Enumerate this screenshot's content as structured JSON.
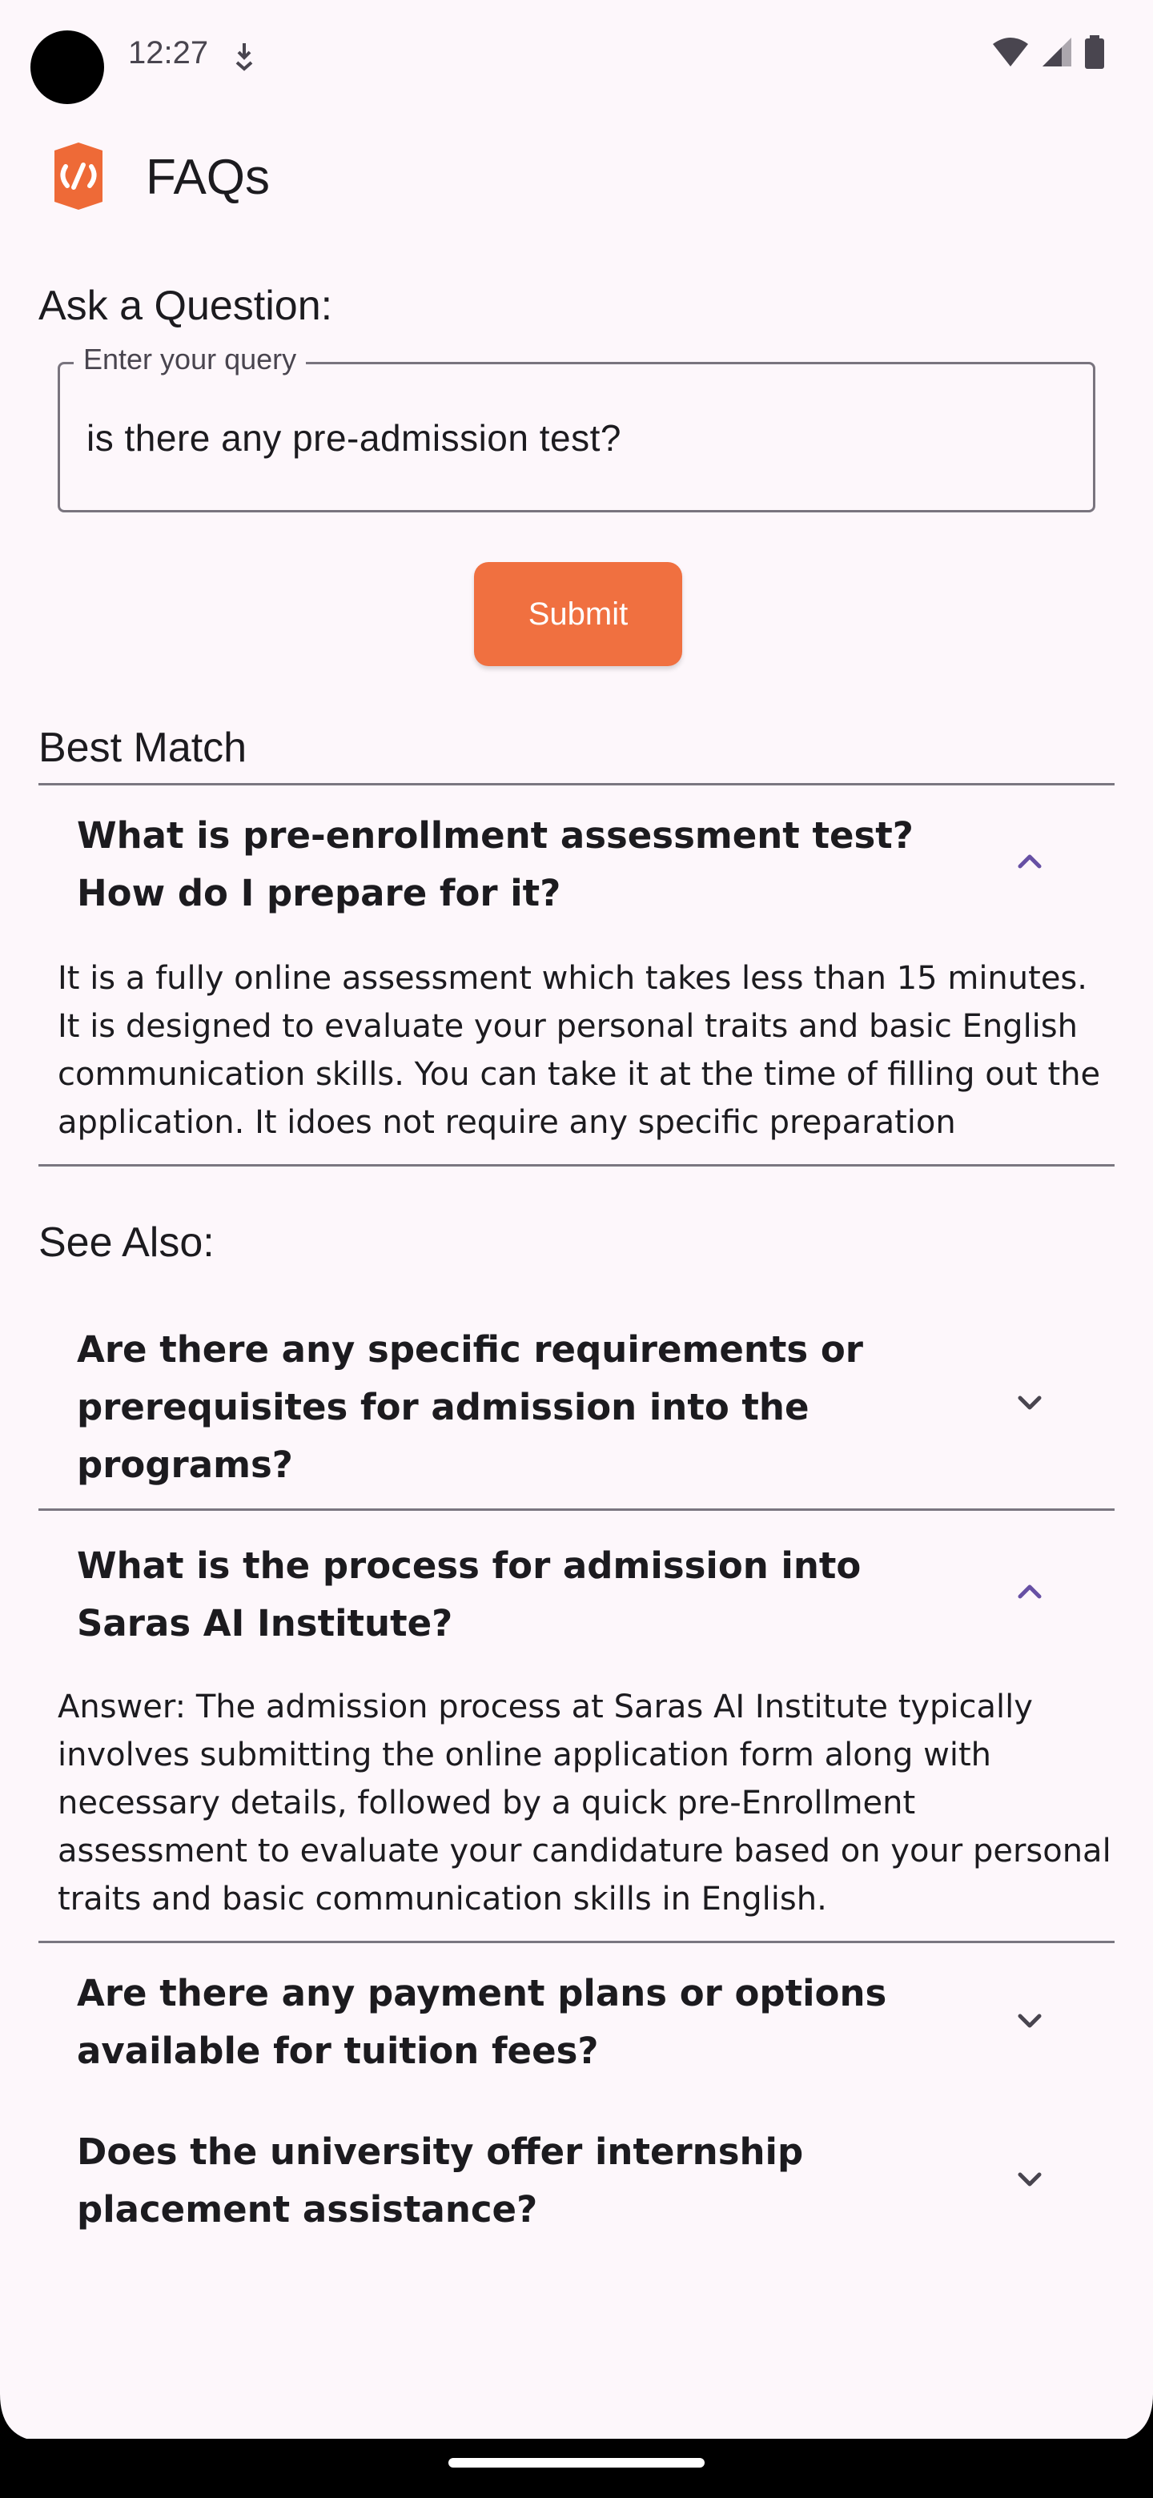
{
  "status_bar": {
    "time": "12:27"
  },
  "app_bar": {
    "title": "FAQs"
  },
  "ask": {
    "label": "Ask a Question:",
    "field_label": "Enter your query",
    "field_value": "is there any pre-admission test?"
  },
  "submit_label": "Submit",
  "best_match": {
    "heading": "Best Match",
    "question": "What is pre-enrollment assessment test? How do I prepare for it?",
    "answer": "It is a fully online assessment which takes less than 15 minutes. It is designed to evaluate your personal traits and basic English communication skills. You can take it at the time of filling out the application. It idoes not require any specific preparation"
  },
  "see_also": {
    "heading": "See Also:",
    "items": [
      {
        "question": "Are there any specific requirements or prerequisites for admission into the programs?",
        "expanded": false
      },
      {
        "question": "What is the process for admission into Saras AI Institute?",
        "expanded": true,
        "answer": "Answer: The admission process at Saras AI Institute typically involves submitting the online application form along with necessary details, followed by a quick pre-Enrollment assessment to evaluate your candidature based on your personal traits and basic communication skills in English."
      },
      {
        "question": "Are there any payment plans or options available for tuition fees?",
        "expanded": false
      },
      {
        "question": " Does the university offer internship placement assistance?",
        "expanded": false
      }
    ]
  },
  "colors": {
    "accent": "#f07040",
    "chevron_expanded": "#6750a4",
    "chevron_collapsed": "#49454f",
    "background": "#fdf7fb"
  }
}
